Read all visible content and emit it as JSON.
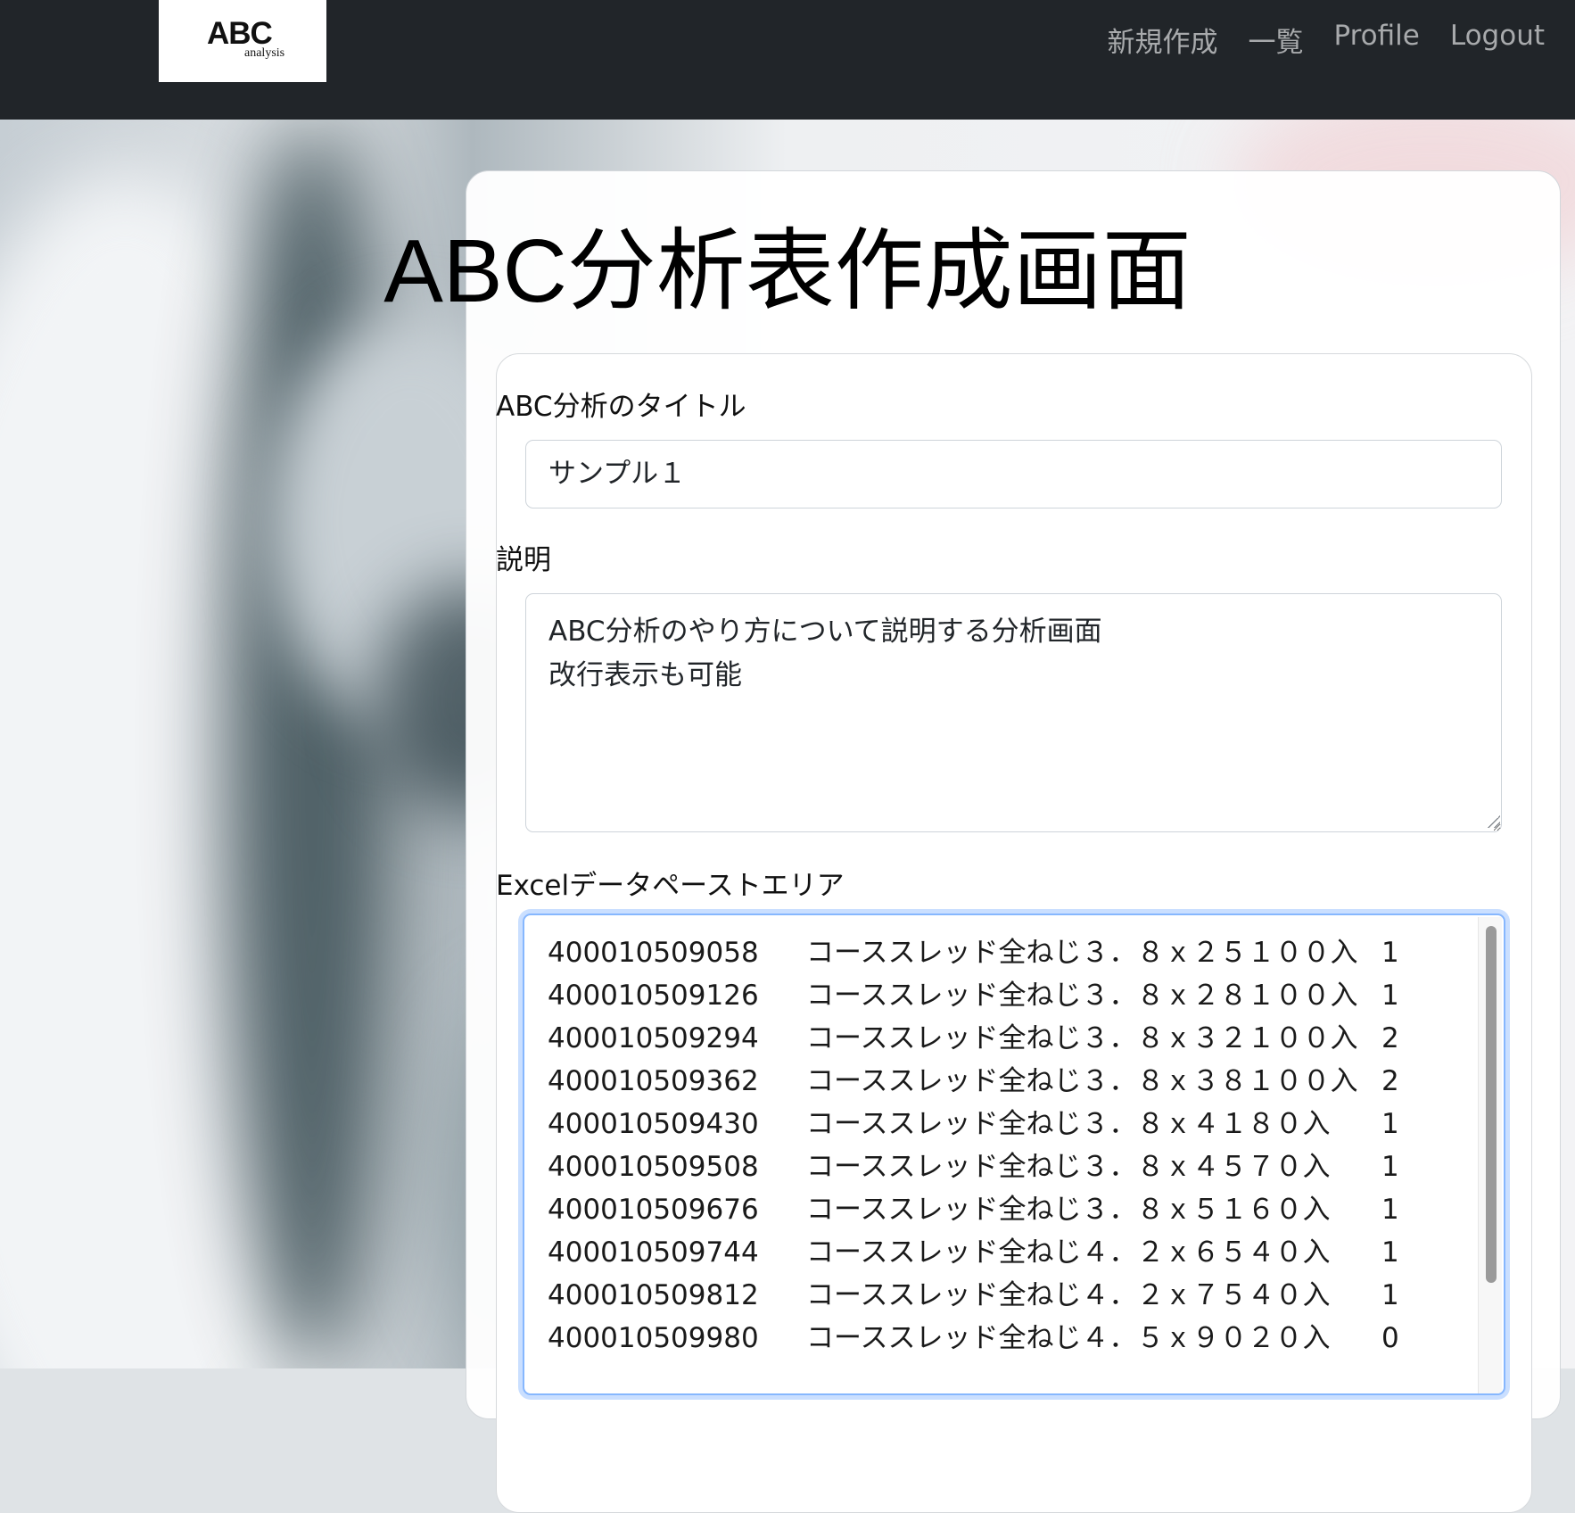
{
  "navbar": {
    "logo_text": "ABC",
    "logo_sub": "analysis",
    "links": [
      "新規作成",
      "一覧",
      "Profile",
      "Logout"
    ]
  },
  "page": {
    "title": "ABC分析表作成画面"
  },
  "form": {
    "title_label": "ABC分析のタイトル",
    "title_value": "サンプル１",
    "description_label": "説明",
    "description_value": "ABC分析のやり方について説明する分析画面\n改行表示も可能",
    "excel_label": "Excelデータペーストエリア",
    "excel_rows": [
      {
        "code": "400010509058",
        "name": "コーススレッド全ねじ３．８ｘ２５１００入",
        "qty": "1"
      },
      {
        "code": "400010509126",
        "name": "コーススレッド全ねじ３．８ｘ２８１００入",
        "qty": "1"
      },
      {
        "code": "400010509294",
        "name": "コーススレッド全ねじ３．８ｘ３２１００入",
        "qty": "2"
      },
      {
        "code": "400010509362",
        "name": "コーススレッド全ねじ３．８ｘ３８１００入",
        "qty": "2"
      },
      {
        "code": "400010509430",
        "name": "コーススレッド全ねじ３．８ｘ４１８０入",
        "qty": "1"
      },
      {
        "code": "400010509508",
        "name": "コーススレッド全ねじ３．８ｘ４５７０入",
        "qty": "1"
      },
      {
        "code": "400010509676",
        "name": "コーススレッド全ねじ３．８ｘ５１６０入",
        "qty": "1"
      },
      {
        "code": "400010509744",
        "name": "コーススレッド全ねじ４．２ｘ６５４０入",
        "qty": "1"
      },
      {
        "code": "400010509812",
        "name": "コーススレッド全ねじ４．２ｘ７５４０入",
        "qty": "1"
      },
      {
        "code": "400010509980",
        "name": "コーススレッド全ねじ４．５ｘ９０２０入",
        "qty": "0"
      }
    ]
  }
}
